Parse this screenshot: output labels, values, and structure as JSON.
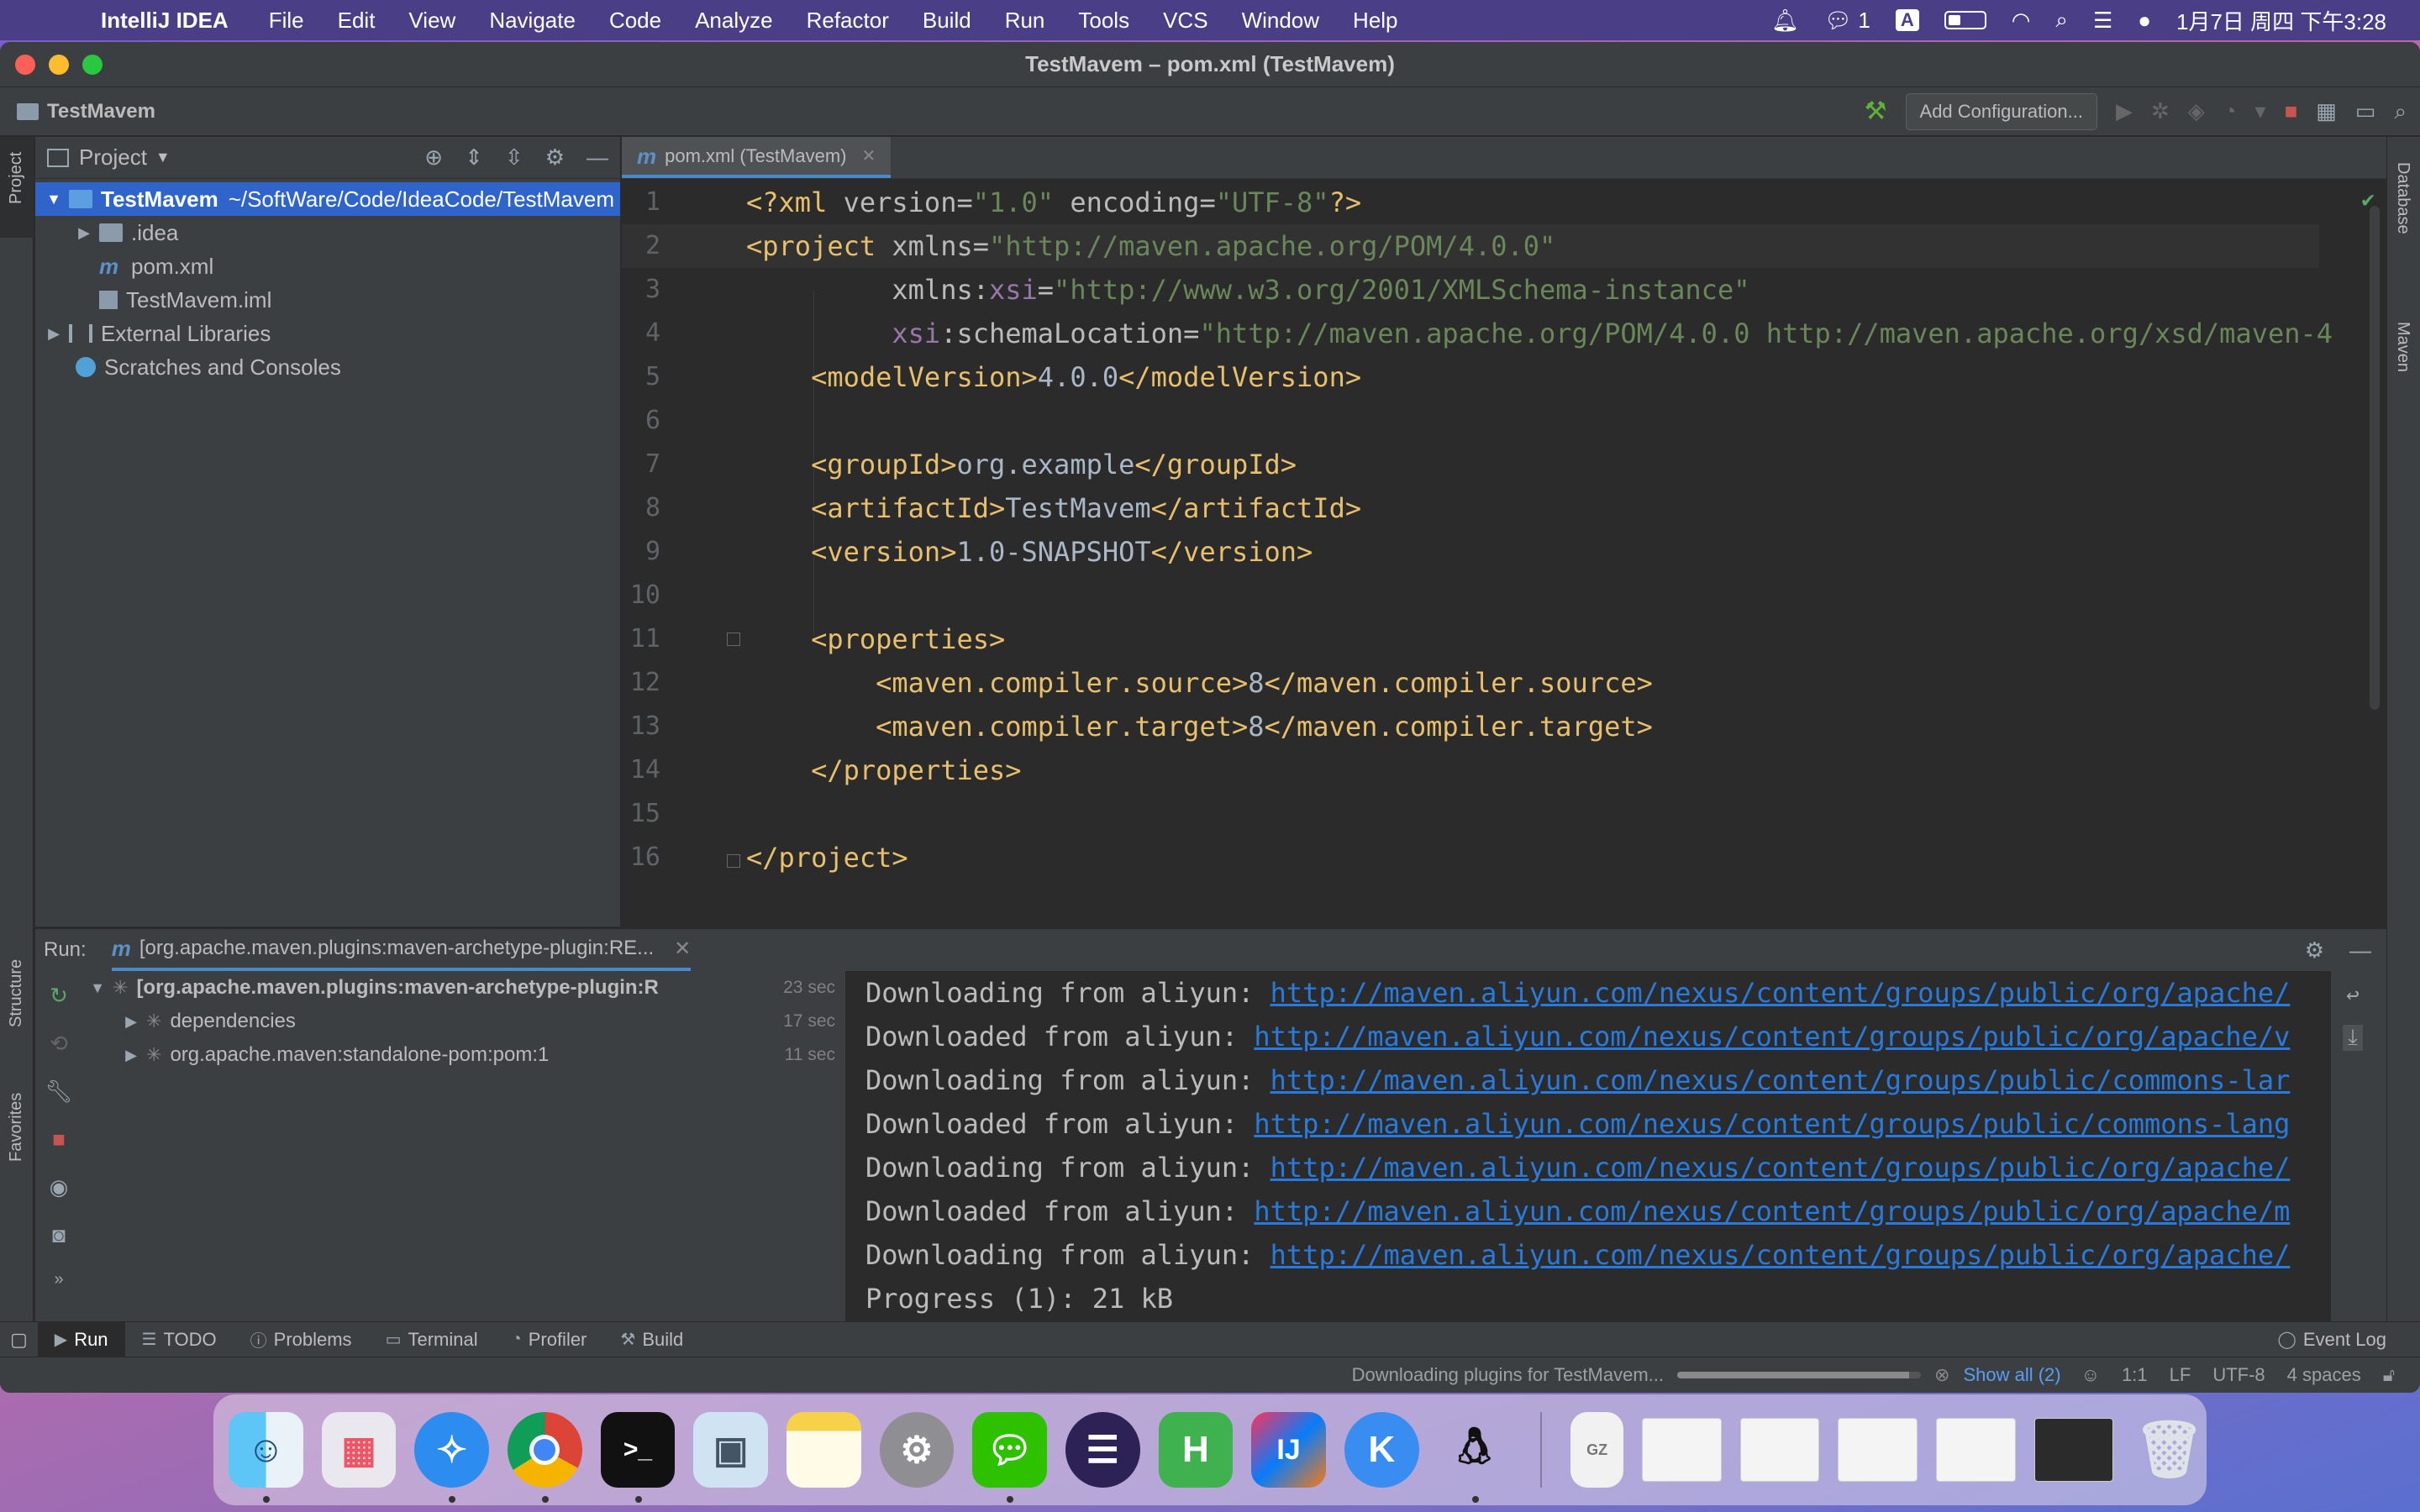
{
  "menubar": {
    "app_name": "IntelliJ IDEA",
    "menus": [
      "File",
      "Edit",
      "View",
      "Navigate",
      "Code",
      "Analyze",
      "Refactor",
      "Build",
      "Run",
      "Tools",
      "VCS",
      "Window",
      "Help"
    ],
    "wechat_count": "1",
    "input_method": "A",
    "clock": "1月7日 周四 下午3:28"
  },
  "window": {
    "title": "TestMavem – pom.xml (TestMavem)"
  },
  "navbar": {
    "breadcrumb": "TestMavem",
    "add_configuration": "Add Configuration..."
  },
  "left_stripe": {
    "project": "Project",
    "structure": "Structure",
    "favorites": "Favorites"
  },
  "right_stripe": {
    "database": "Database",
    "maven": "Maven"
  },
  "project_panel": {
    "title": "Project",
    "tree": [
      {
        "name": "TestMavem",
        "path": "~/SoftWare/Code/IdeaCode/TestMavem"
      },
      {
        "name": ".idea"
      },
      {
        "name": "pom.xml"
      },
      {
        "name": "TestMavem.iml"
      },
      {
        "name": "External Libraries"
      },
      {
        "name": "Scratches and Consoles"
      }
    ]
  },
  "editor": {
    "tab_label": "pom.xml (TestMavem)",
    "line_numbers": [
      "1",
      "2",
      "3",
      "4",
      "5",
      "6",
      "7",
      "8",
      "9",
      "10",
      "11",
      "12",
      "13",
      "14",
      "15",
      "16"
    ]
  },
  "run_panel": {
    "label": "Run:",
    "tab_title": "[org.apache.maven.plugins:maven-archetype-plugin:RE...",
    "tree": [
      {
        "label": "[org.apache.maven.plugins:maven-archetype-plugin:R",
        "time": "23 sec"
      },
      {
        "label": "dependencies",
        "time": "17 sec"
      },
      {
        "label": "org.apache.maven:standalone-pom:pom:1",
        "time": "11 sec"
      }
    ],
    "console": [
      {
        "prefix": "Downloading from aliyun: ",
        "url": "http://maven.aliyun.com/nexus/content/groups/public/org/apache/"
      },
      {
        "prefix": "Downloaded from aliyun: ",
        "url": "http://maven.aliyun.com/nexus/content/groups/public/org/apache/v"
      },
      {
        "prefix": "Downloading from aliyun: ",
        "url": "http://maven.aliyun.com/nexus/content/groups/public/commons-lar"
      },
      {
        "prefix": "Downloaded from aliyun: ",
        "url": "http://maven.aliyun.com/nexus/content/groups/public/commons-lang"
      },
      {
        "prefix": "Downloading from aliyun: ",
        "url": "http://maven.aliyun.com/nexus/content/groups/public/org/apache/"
      },
      {
        "prefix": "Downloaded from aliyun: ",
        "url": "http://maven.aliyun.com/nexus/content/groups/public/org/apache/m"
      },
      {
        "prefix": "Downloading from aliyun: ",
        "url": "http://maven.aliyun.com/nexus/content/groups/public/org/apache/"
      }
    ],
    "progress": "Progress (1): 21 kB"
  },
  "bottom_tools": {
    "run": "Run",
    "todo": "TODO",
    "problems": "Problems",
    "terminal": "Terminal",
    "profiler": "Profiler",
    "build": "Build",
    "event_log": "Event Log"
  },
  "statusbar": {
    "task": "Downloading plugins for TestMavem...",
    "task_progress": 0.95,
    "show_all": "Show all (2)",
    "position": "1:1",
    "line_sep": "LF",
    "encoding": "UTF-8",
    "indent": "4 spaces"
  },
  "dock": {
    "apps": [
      "finder-icon",
      "launchpad-icon",
      "safari-icon",
      "chrome-icon",
      "terminal-icon",
      "preview-icon",
      "notes-icon",
      "system-preferences-icon",
      "wechat-icon",
      "eclipse-icon",
      "hbuilder-icon",
      "intellij-icon",
      "k-app-icon",
      "qq-icon"
    ],
    "labels": {
      "hbuilder": "H",
      "intellij": "IJ",
      "kapp": "K",
      "archive": "GZ"
    }
  }
}
